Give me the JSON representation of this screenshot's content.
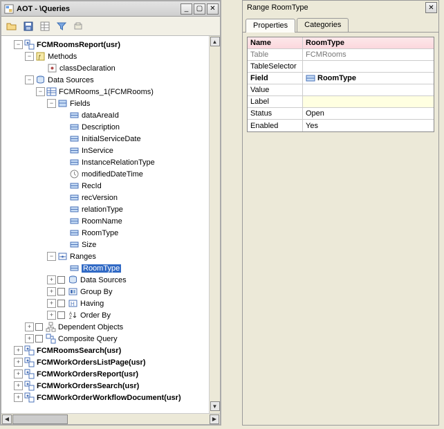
{
  "aot": {
    "title": "AOT - \\Queries",
    "root": {
      "label": "FCMRoomsReport(usr)",
      "children": {
        "methods": "Methods",
        "classDeclaration": "classDeclaration",
        "dataSources": "Data Sources",
        "ds1": "FCMRooms_1(FCMRooms)",
        "fields": "Fields",
        "fieldsList": [
          "dataAreaId",
          "Description",
          "InitialServiceDate",
          "InService",
          "InstanceRelationType",
          "modifiedDateTime",
          "RecId",
          "recVersion",
          "relationType",
          "RoomName",
          "RoomType",
          "Size"
        ],
        "ranges": "Ranges",
        "rangesList": [
          "RoomType"
        ],
        "dsNested": "Data Sources",
        "groupBy": "Group By",
        "having": "Having",
        "orderBy": "Order By",
        "dependent": "Dependent Objects",
        "composite": "Composite Query",
        "peers": [
          "FCMRoomsSearch(usr)",
          "FCMWorkOrdersListPage(usr)",
          "FCMWorkOrdersReport(usr)",
          "FCMWorkOrdersSearch(usr)",
          "FCMWorkOrderWorkflowDocument(usr)"
        ]
      }
    }
  },
  "rightPane": {
    "title": "Range RoomType",
    "tabs": {
      "properties": "Properties",
      "categories": "Categories"
    },
    "header": {
      "name": "Name",
      "value": "RoomType"
    },
    "rows": {
      "table": {
        "name": "Table",
        "value": "FCMRooms"
      },
      "tableSelector": {
        "name": "TableSelector",
        "value": ""
      },
      "field": {
        "name": "Field",
        "value": "RoomType"
      },
      "value": {
        "name": "Value",
        "value": ""
      },
      "label": {
        "name": "Label",
        "value": ""
      },
      "status": {
        "name": "Status",
        "value": "Open"
      },
      "enabled": {
        "name": "Enabled",
        "value": "Yes"
      }
    }
  }
}
